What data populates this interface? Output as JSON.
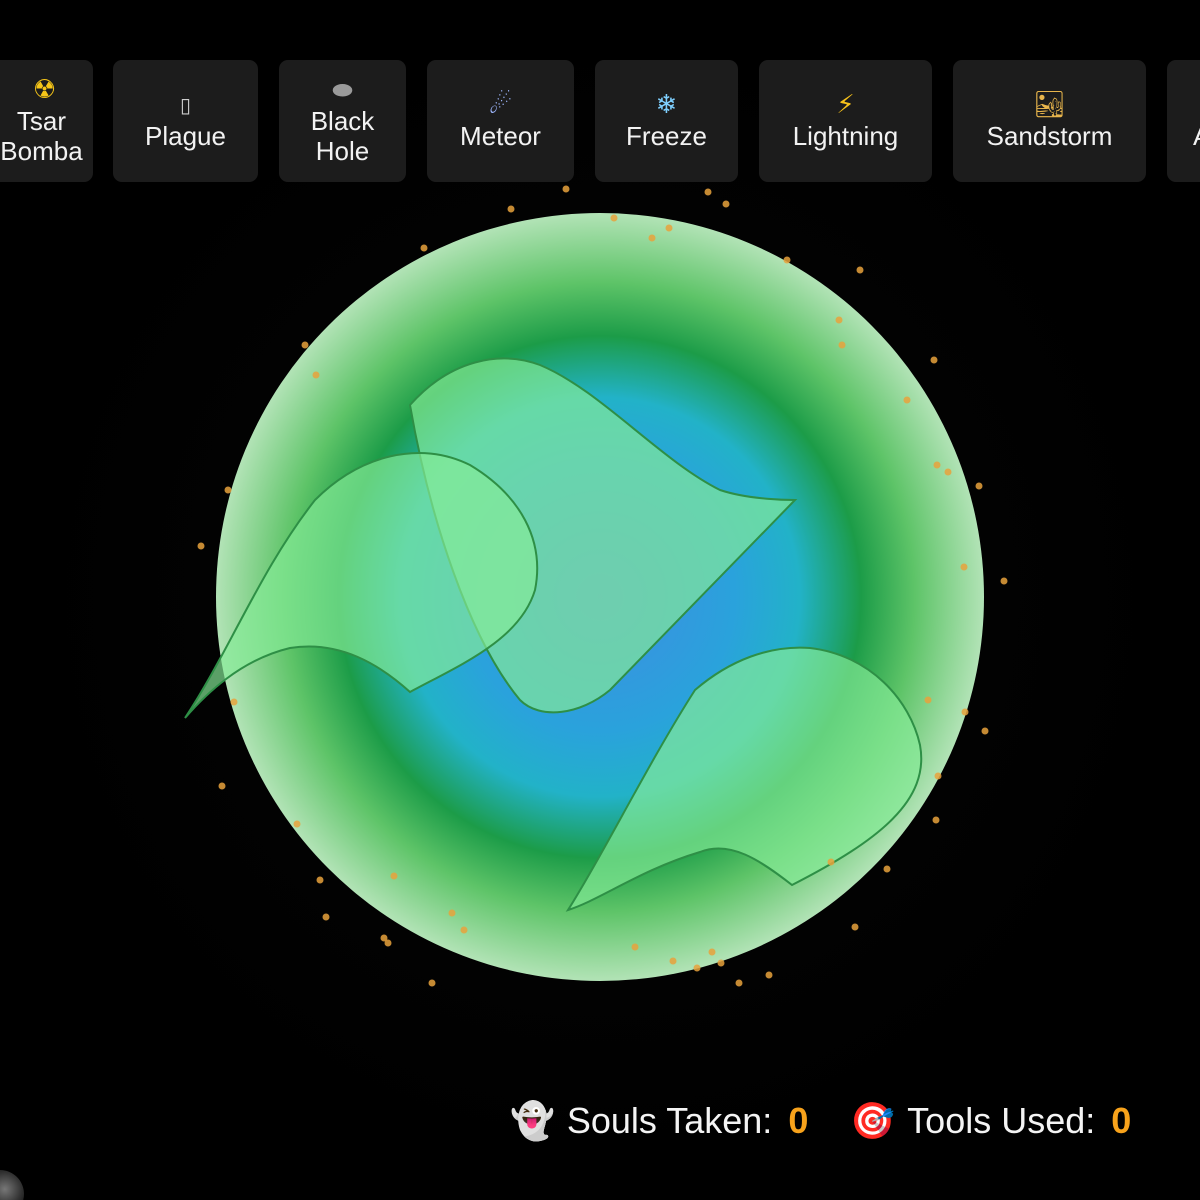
{
  "toolbar": {
    "tools": [
      {
        "label": "Tsar\nBomba",
        "icon": "☢"
      },
      {
        "label": "Plague",
        "icon": "▯"
      },
      {
        "label": "Black\nHole",
        "icon": "⬬"
      },
      {
        "label": "Meteor",
        "icon": "☄"
      },
      {
        "label": "Freeze",
        "icon": "❄"
      },
      {
        "label": "Lightning",
        "icon": "⚡"
      },
      {
        "label": "Sandstorm",
        "icon": "🏜"
      },
      {
        "label": "A",
        "icon": ""
      }
    ]
  },
  "stats": {
    "souls_icon": "👻",
    "souls_label": "Souls Taken:",
    "souls_value": "0",
    "tools_icon": "🎯",
    "tools_label": "Tools Used:",
    "tools_value": "0"
  },
  "colors": {
    "accent": "#f7a21b",
    "tool_bg": "#1c1c1c",
    "ocean_center": "#3e8de0",
    "ocean_mid": "#22b0d8",
    "land_ring": "#1e9a3e",
    "atmosphere": "#a8ddb0",
    "continent": "#7de89a",
    "particle": "#e8a23c"
  }
}
